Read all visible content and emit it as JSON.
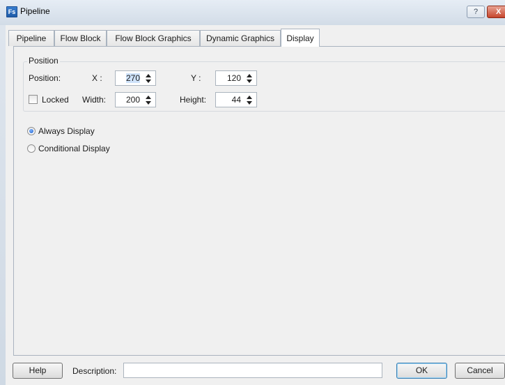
{
  "window": {
    "app_icon": "Fs",
    "title": "Pipeline",
    "help_glyph": "?",
    "close_glyph": "X"
  },
  "tabs": [
    {
      "label": "Pipeline",
      "active": false
    },
    {
      "label": "Flow Block",
      "active": false
    },
    {
      "label": "Flow Block Graphics",
      "active": false
    },
    {
      "label": "Dynamic Graphics",
      "active": false
    },
    {
      "label": "Display",
      "active": true
    }
  ],
  "position_group": {
    "title": "Position",
    "position_label": "Position:",
    "x_label": "X :",
    "x_value": "270",
    "y_label": "Y :",
    "y_value": "120",
    "locked_label": "Locked",
    "locked_checked": false,
    "width_label": "Width:",
    "width_value": "200",
    "height_label": "Height:",
    "height_value": "44"
  },
  "display_mode": {
    "options": [
      {
        "label": "Always Display",
        "selected": true
      },
      {
        "label": "Conditional Display",
        "selected": false
      }
    ]
  },
  "footer": {
    "help_label": "Help",
    "description_label": "Description:",
    "description_value": "",
    "ok_label": "OK",
    "cancel_label": "Cancel"
  }
}
